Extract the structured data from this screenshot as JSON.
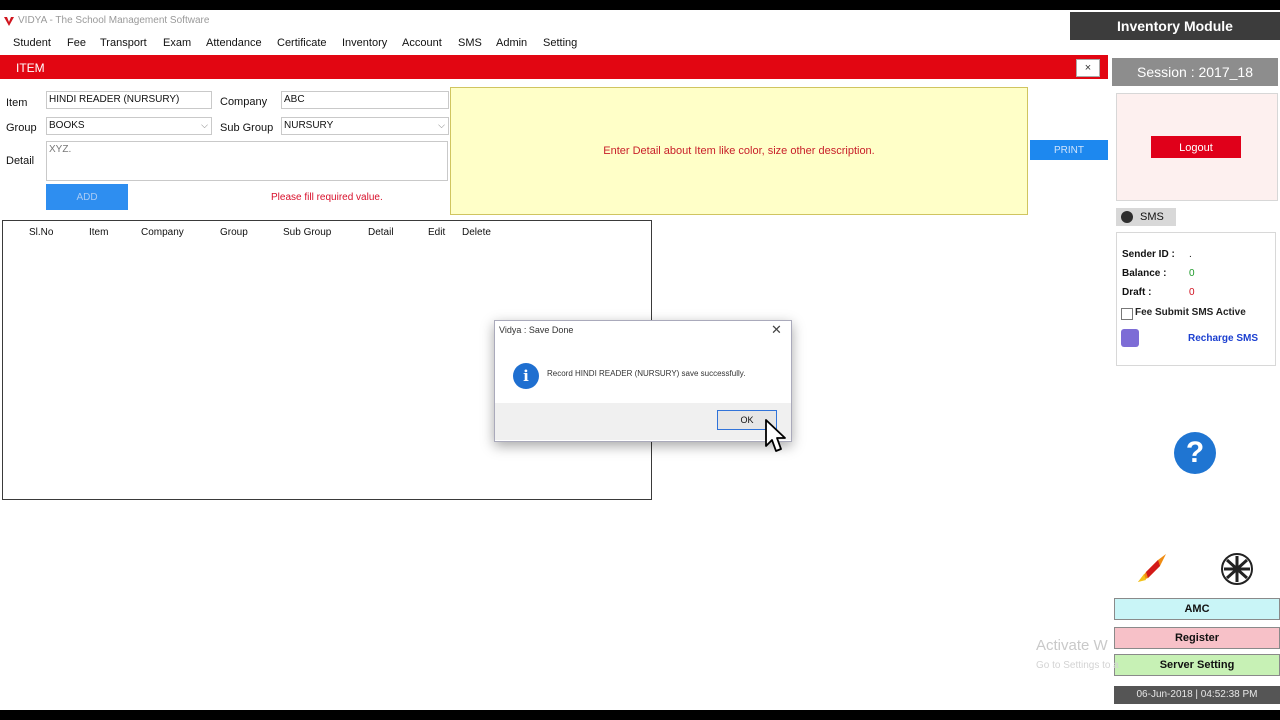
{
  "window": {
    "title": "VIDYA - The School Management Software"
  },
  "menu": {
    "items": [
      "Student",
      "Fee",
      "Transport",
      "Exam",
      "Attendance",
      "Certificate",
      "Inventory",
      "Account",
      "SMS",
      "Admin",
      "Setting"
    ]
  },
  "side_panel": {
    "module_title": "Inventory Module",
    "session": "Session : 2017_18",
    "logout_label": "Logout",
    "sms_tab": "SMS",
    "sender_id_label": "Sender ID :",
    "sender_id_value": ".",
    "balance_label": "Balance :",
    "balance_value": "0",
    "draft_label": "Draft :",
    "draft_value": "0",
    "fee_submit_label": "Fee Submit SMS Active",
    "recharge_label": "Recharge SMS",
    "help_symbol": "?",
    "amc_label": "AMC",
    "register_label": "Register",
    "server_label": "Server Setting",
    "datetime": "06-Jun-2018 | 04:52:38 PM",
    "colors": {
      "amc_bg": "#c9f5f7",
      "register_bg": "#f7c1c8",
      "server_bg": "#c7f1b5"
    }
  },
  "item_form": {
    "header": "ITEM",
    "close_symbol": "×",
    "item_label": "Item",
    "item_value": "HINDI READER (NURSURY)",
    "company_label": "Company",
    "company_value": "ABC",
    "group_label": "Group",
    "group_value": "BOOKS",
    "subgroup_label": "Sub Group",
    "subgroup_value": "NURSURY",
    "detail_label": "Detail",
    "detail_value": "XYZ.",
    "add_label": "ADD",
    "required_msg": "Please fill required value.",
    "hint": "Enter Detail about Item like color, size other description.",
    "print_label": "PRINT"
  },
  "grid": {
    "columns": [
      "Sl.No",
      "Item",
      "Company",
      "Group",
      "Sub Group",
      "Detail",
      "Edit",
      "Delete"
    ]
  },
  "dialog": {
    "title": "Vidya : Save Done",
    "close_symbol": "✕",
    "info_symbol": "i",
    "message": "Record HINDI READER (NURSURY) save successfully.",
    "ok_label": "OK"
  },
  "watermark": {
    "line1": "Activate W",
    "line2": "Go to Settings to a"
  }
}
